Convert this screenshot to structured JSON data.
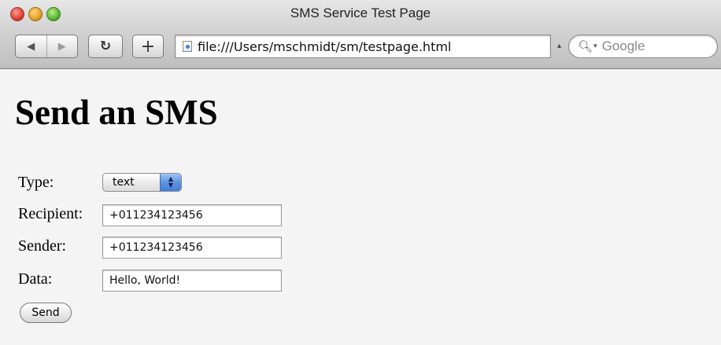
{
  "window": {
    "title": "SMS Service Test Page"
  },
  "toolbar": {
    "back_icon": "left-arrow-icon",
    "forward_icon": "right-arrow-icon",
    "reload_glyph": "↻",
    "add_bookmark_glyph": "+",
    "url": "file:///Users/mschmidt/sm/testpage.html",
    "search_placeholder": "Google"
  },
  "page": {
    "heading": "Send an SMS",
    "form": {
      "type_label": "Type:",
      "type_value": "text",
      "recipient_label": "Recipient:",
      "recipient_value": "+011234123456",
      "sender_label": "Sender:",
      "sender_value": "+011234123456",
      "data_label": "Data:",
      "data_value": "Hello, World!",
      "send_label": "Send"
    }
  },
  "colors": {
    "page_background": "#f4f4f4",
    "select_arrow_blue": "#5e95e0"
  }
}
